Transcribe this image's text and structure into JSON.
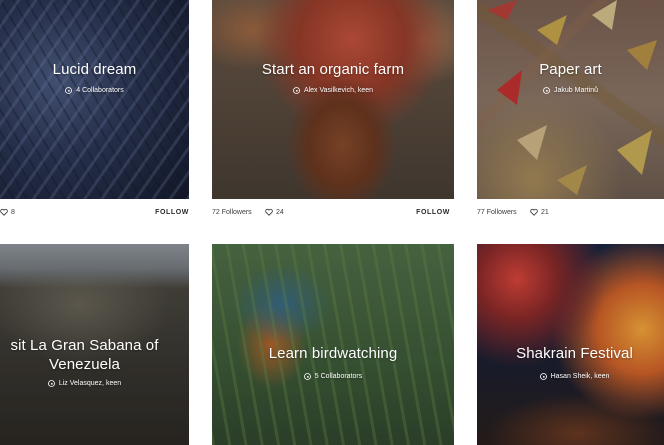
{
  "cards": [
    {
      "title": "Lucid dream",
      "meta": "4 Collaborators",
      "likes": "8",
      "follow": "FOLLOW"
    },
    {
      "title": "Start an organic farm",
      "meta": "Alex Vasilkevich, keen",
      "followers": "72 Followers",
      "likes": "24",
      "follow": "FOLLOW"
    },
    {
      "title": "Paper art",
      "meta": "Jakub Martinů",
      "followers": "77 Followers",
      "likes": "21"
    },
    {
      "title_line1": "sit La Gran Sabana of",
      "title_line2": "Venezuela",
      "meta": "Liz Velasquez, keen"
    },
    {
      "title": "Learn birdwatching",
      "meta": "5 Collaborators"
    },
    {
      "title": "Shakrain Festival",
      "meta": "Hasan Sheik, keen"
    }
  ],
  "icons": {
    "meta_icon": "globe-icon",
    "likes_icon": "heart-icon"
  },
  "colors": {
    "text_on_image": "#ffffff",
    "footer_text": "#3d3d3d",
    "background": "#ffffff"
  }
}
